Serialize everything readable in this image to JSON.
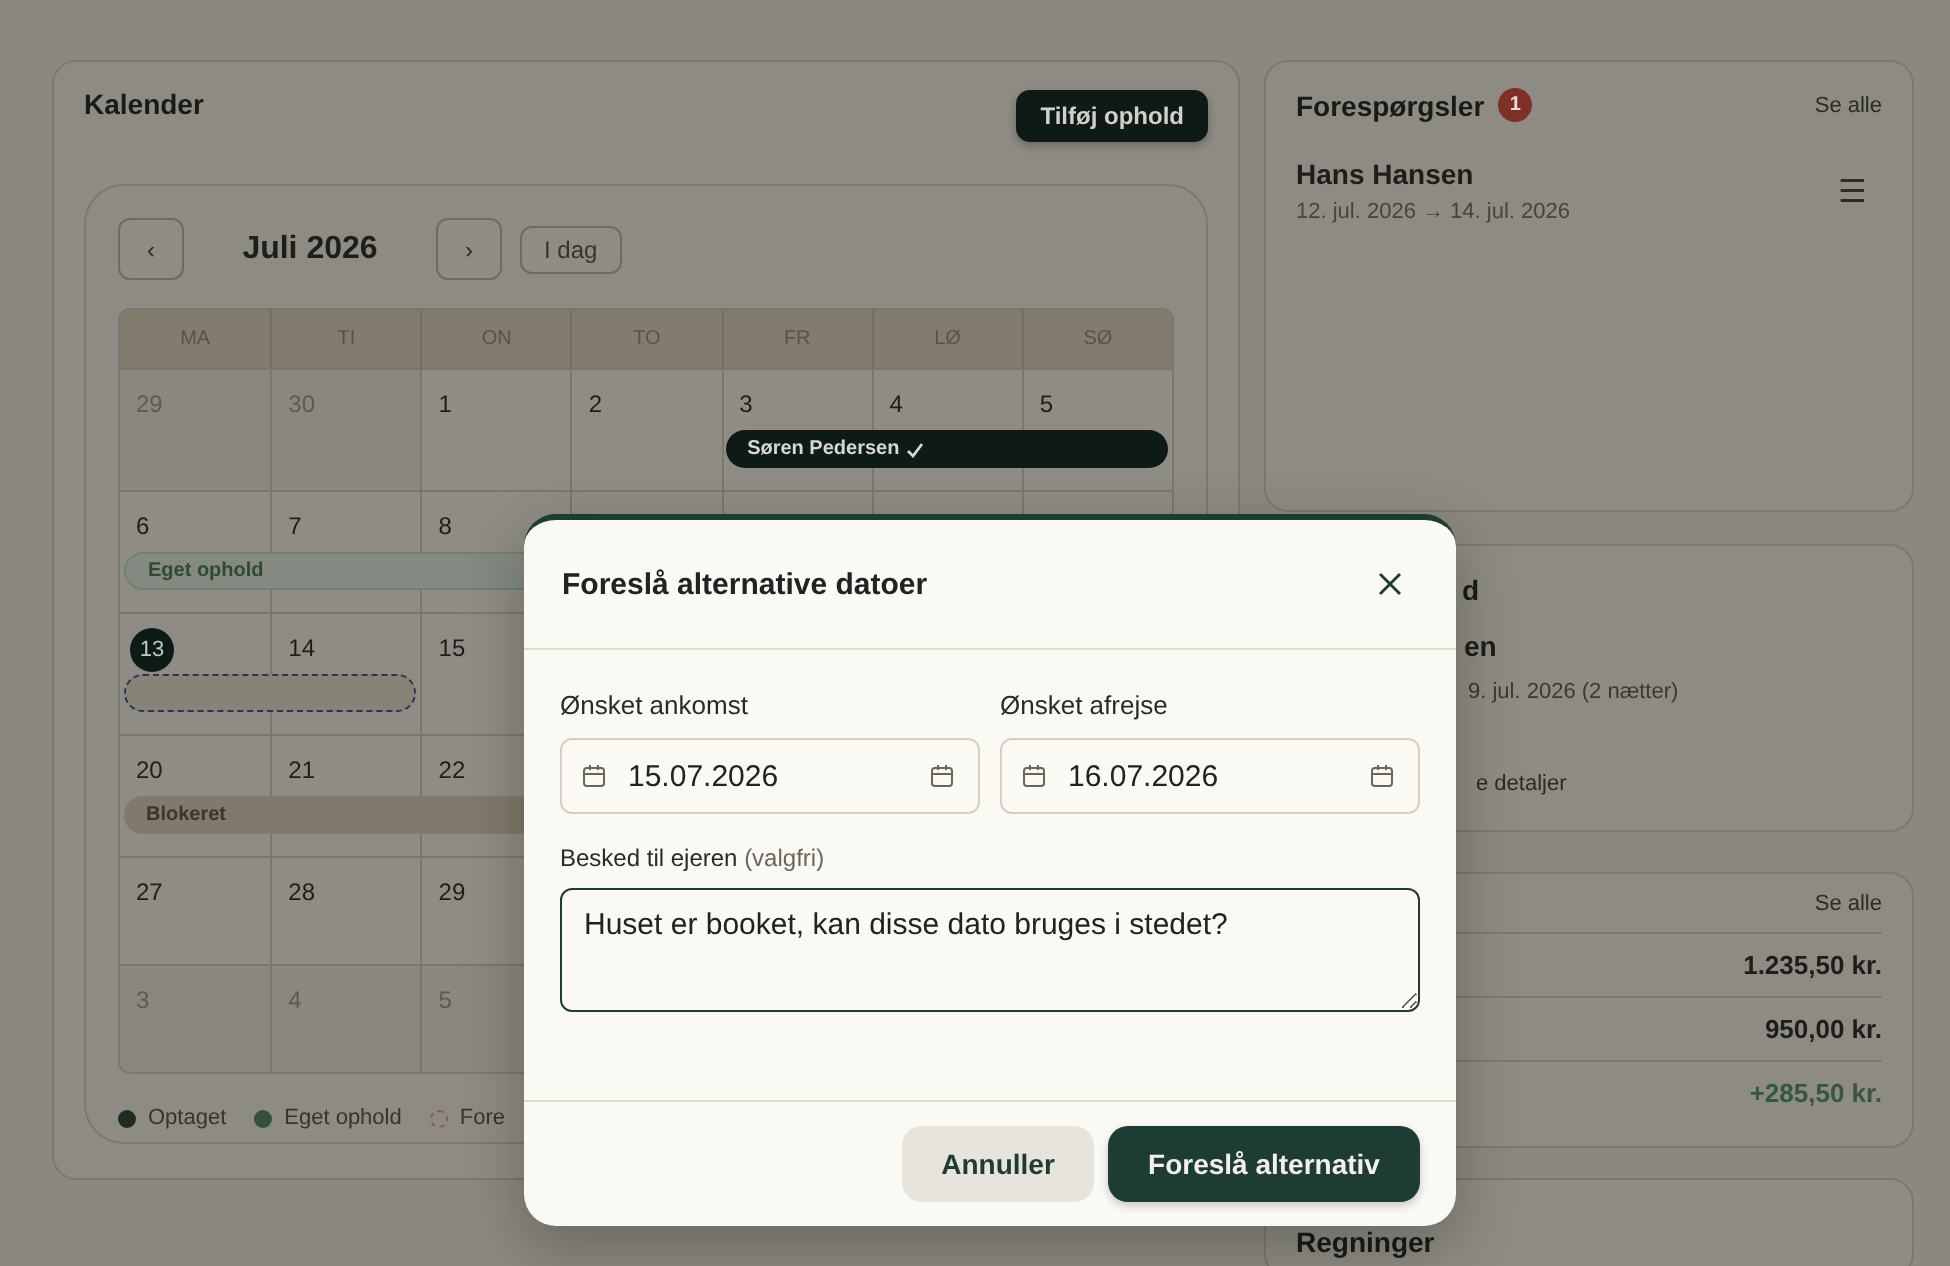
{
  "calendar": {
    "title": "Kalender",
    "add_button": "Tilføj ophold",
    "prev": "‹",
    "month": "Juli 2026",
    "next": "›",
    "today_button": "I dag",
    "weekdays": [
      "MA",
      "TI",
      "ON",
      "TO",
      "FR",
      "LØ",
      "SØ"
    ],
    "weeks": [
      {
        "days": [
          {
            "label": "29",
            "muted": true,
            "today": false,
            "covered": false
          },
          {
            "label": "30",
            "muted": true,
            "today": false,
            "covered": false
          },
          {
            "label": "1",
            "muted": false,
            "today": false,
            "covered": false
          },
          {
            "label": "2",
            "muted": false,
            "today": false,
            "covered": false
          },
          {
            "label": "3",
            "muted": false,
            "today": false,
            "covered": true,
            "event": {
              "kind": "booking",
              "label": "Søren Pedersen",
              "confirmed": true
            }
          },
          {
            "label": "4",
            "muted": false,
            "today": false,
            "covered": true
          },
          {
            "label": "5",
            "muted": false,
            "today": false,
            "covered": true
          }
        ]
      },
      {
        "days": [
          {
            "label": "6",
            "muted": false,
            "today": false,
            "covered": true,
            "event": {
              "kind": "own",
              "label": "Eget ophold",
              "confirmed": false
            }
          },
          {
            "label": "7",
            "muted": false,
            "today": false,
            "covered": true
          },
          {
            "label": "8",
            "muted": false,
            "today": false,
            "covered": true
          }
        ]
      },
      {
        "days": [
          {
            "label": "13",
            "muted": false,
            "today": true,
            "covered": true,
            "event": {
              "kind": "selection"
            }
          },
          {
            "label": "14",
            "muted": false,
            "today": false,
            "covered": true
          },
          {
            "label": "15",
            "muted": false,
            "today": false,
            "covered": false
          }
        ]
      },
      {
        "days": [
          {
            "label": "20",
            "muted": false,
            "today": false,
            "covered": true,
            "event": {
              "kind": "blocked",
              "label": "Blokeret",
              "confirmed": false
            }
          },
          {
            "label": "21",
            "muted": false,
            "today": false,
            "covered": true
          },
          {
            "label": "22",
            "muted": false,
            "today": false,
            "covered": true
          }
        ]
      },
      {
        "days": [
          {
            "label": "27",
            "muted": false,
            "today": false,
            "covered": false
          },
          {
            "label": "28",
            "muted": false,
            "today": false,
            "covered": false
          },
          {
            "label": "29",
            "muted": false,
            "today": false,
            "covered": false
          }
        ]
      },
      {
        "days": [
          {
            "label": "3",
            "muted": true,
            "today": false,
            "covered": false
          },
          {
            "label": "4",
            "muted": true,
            "today": false,
            "covered": false
          },
          {
            "label": "5",
            "muted": true,
            "today": false,
            "covered": false
          }
        ]
      }
    ],
    "legend": [
      {
        "label": "Optaget",
        "color": "#1f2b23",
        "kind": "solid"
      },
      {
        "label": "Eget ophold",
        "color": "#33503b",
        "kind": "solid"
      },
      {
        "label": "Fore",
        "color": "#8a6238",
        "kind": "dashed"
      }
    ]
  },
  "requests": {
    "title": "Forespørgsler",
    "badge": "1",
    "see_all": "Se alle",
    "items": [
      {
        "name": "Hans Hansen",
        "dates": "12. jul. 2026 → 14. jul. 2026",
        "menu": "☰"
      }
    ]
  },
  "next_stay": {
    "title": "d",
    "name": "en",
    "dates": "9. jul. 2026 (2 nætter)",
    "link": "e detaljer"
  },
  "economy": {
    "see_all": "Se alle",
    "rows": [
      {
        "amount": "1.235,50 kr.",
        "kind": "default"
      },
      {
        "amount": "950,00 kr.",
        "kind": "default"
      },
      {
        "amount": "+285,50 kr.",
        "kind": "positive"
      }
    ]
  },
  "bills": {
    "title": "Regninger"
  },
  "dialog": {
    "title": "Foreslå alternative datoer",
    "arrival": {
      "label": "Ønsket ankomst",
      "value": "15.07.2026"
    },
    "departure": {
      "label": "Ønsket afrejse",
      "value": "16.07.2026"
    },
    "message": {
      "label": "Besked til ejeren",
      "hint": "(valgfri)",
      "value": "Huset er booket, kan disse dato bruges i stedet?"
    },
    "cancel": "Annuller",
    "submit": "Foreslå alternativ"
  }
}
